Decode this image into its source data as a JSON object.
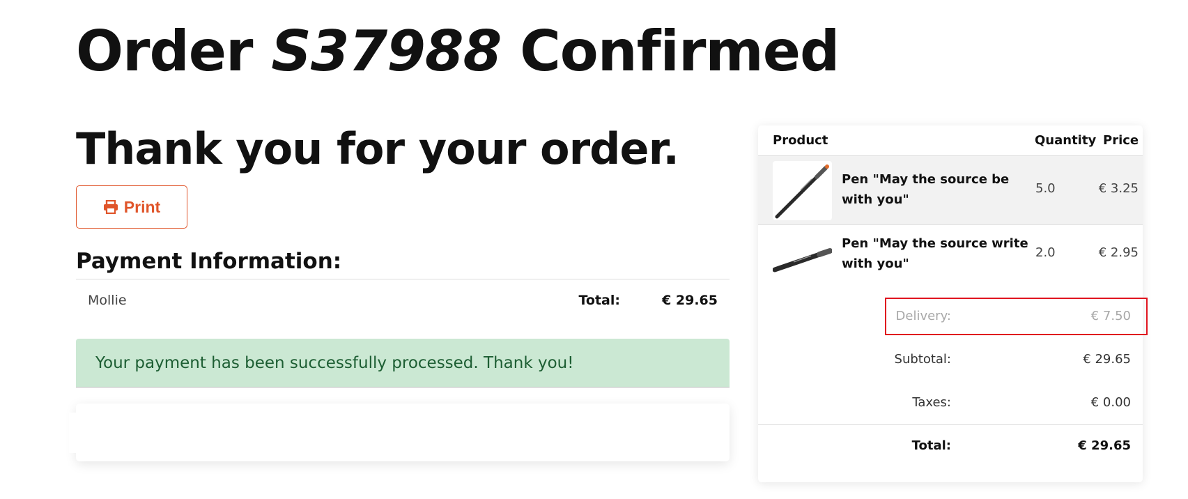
{
  "header": {
    "order_prefix": "Order",
    "order_number": "S37988",
    "order_suffix": "Confirmed"
  },
  "thanks_heading": "Thank you for your order.",
  "print_button": {
    "label": "Print",
    "icon": "print-icon"
  },
  "payment": {
    "heading": "Payment Information:",
    "method": "Mollie",
    "total_label": "Total:",
    "total_value": "€ 29.65"
  },
  "alert": {
    "message": "Your payment has been successfully processed. Thank you!",
    "background_color": "#cbe8d3",
    "text_color": "#1d5e33"
  },
  "summary": {
    "columns": [
      "Product",
      "Quantity",
      "Price"
    ],
    "items": [
      {
        "name": "Pen \"May the source be with you\"",
        "quantity": "5.0",
        "price": "€ 3.25"
      },
      {
        "name": "Pen \"May the source write with you\"",
        "quantity": "2.0",
        "price": "€ 2.95"
      }
    ],
    "delivery_label": "Delivery:",
    "delivery_value": "€ 7.50",
    "subtotal_label": "Subtotal:",
    "subtotal_value": "€ 29.65",
    "taxes_label": "Taxes:",
    "taxes_value": "€ 0.00",
    "total_label": "Total:",
    "total_value": "€ 29.65"
  },
  "colors": {
    "accent": "#e0552a",
    "highlight": "#e0151f"
  }
}
